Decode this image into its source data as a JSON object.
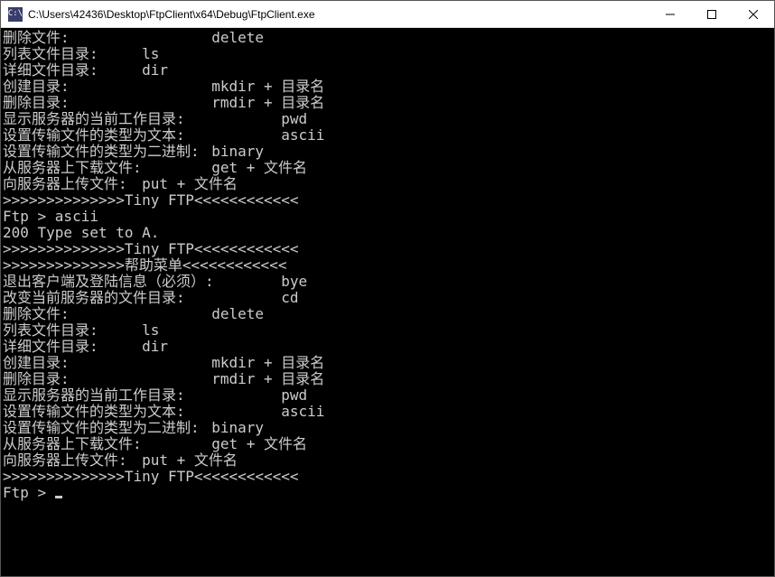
{
  "window": {
    "icon_text": "C:\\",
    "title": "C:\\Users\\42436\\Desktop\\FtpClient\\x64\\Debug\\FtpClient.exe"
  },
  "terminal_lines": [
    "删除文件:\t\tdelete",
    "列表文件目录:\tls",
    "详细文件目录:\tdir",
    "创建目录:\t\tmkdir + 目录名",
    "删除目录:\t\trmdir + 目录名",
    "显示服务器的当前工作目录:\t\tpwd",
    "设置传输文件的类型为文本:\t\tascii",
    "设置传输文件的类型为二进制:\tbinary",
    "从服务器上下载文件:\tget + 文件名",
    "向服务器上传文件:\tput + 文件名",
    ">>>>>>>>>>>>>>Tiny FTP<<<<<<<<<<<<",
    "Ftp > ascii",
    "200 Type set to A.",
    "",
    ">>>>>>>>>>>>>>Tiny FTP<<<<<<<<<<<<",
    ">>>>>>>>>>>>>>帮助菜单<<<<<<<<<<<<",
    "退出客户端及登陆信息（必须）:\tbye",
    "改变当前服务器的文件目录:\t\tcd",
    "删除文件:\t\tdelete",
    "列表文件目录:\tls",
    "详细文件目录:\tdir",
    "创建目录:\t\tmkdir + 目录名",
    "删除目录:\t\trmdir + 目录名",
    "显示服务器的当前工作目录:\t\tpwd",
    "设置传输文件的类型为文本:\t\tascii",
    "设置传输文件的类型为二进制:\tbinary",
    "从服务器上下载文件:\tget + 文件名",
    "向服务器上传文件:\tput + 文件名",
    ">>>>>>>>>>>>>>Tiny FTP<<<<<<<<<<<<"
  ],
  "prompt": "Ftp > "
}
